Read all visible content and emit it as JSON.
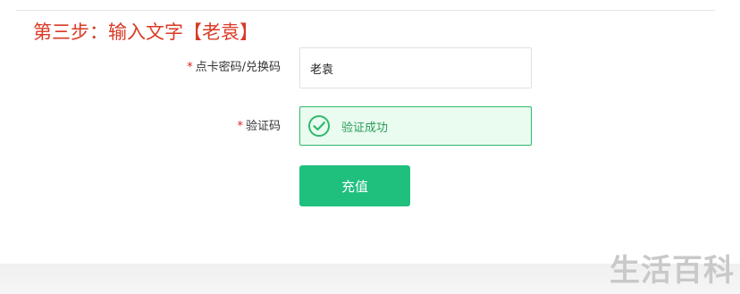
{
  "step_title": "第三步：输入文字【老袁】",
  "form": {
    "required_mark": "*",
    "code_label": "点卡密码/兑换码",
    "code_value": "老袁",
    "verify_label": "验证码",
    "verify_status": "验证成功",
    "submit_label": "充值"
  },
  "watermark": "生活百科",
  "colors": {
    "step_title": "#d93a26",
    "success_border": "#2fb96b",
    "success_bg": "#eafbf0",
    "button": "#1fbf7e"
  },
  "icons": {
    "verify": "check-circle-icon"
  }
}
